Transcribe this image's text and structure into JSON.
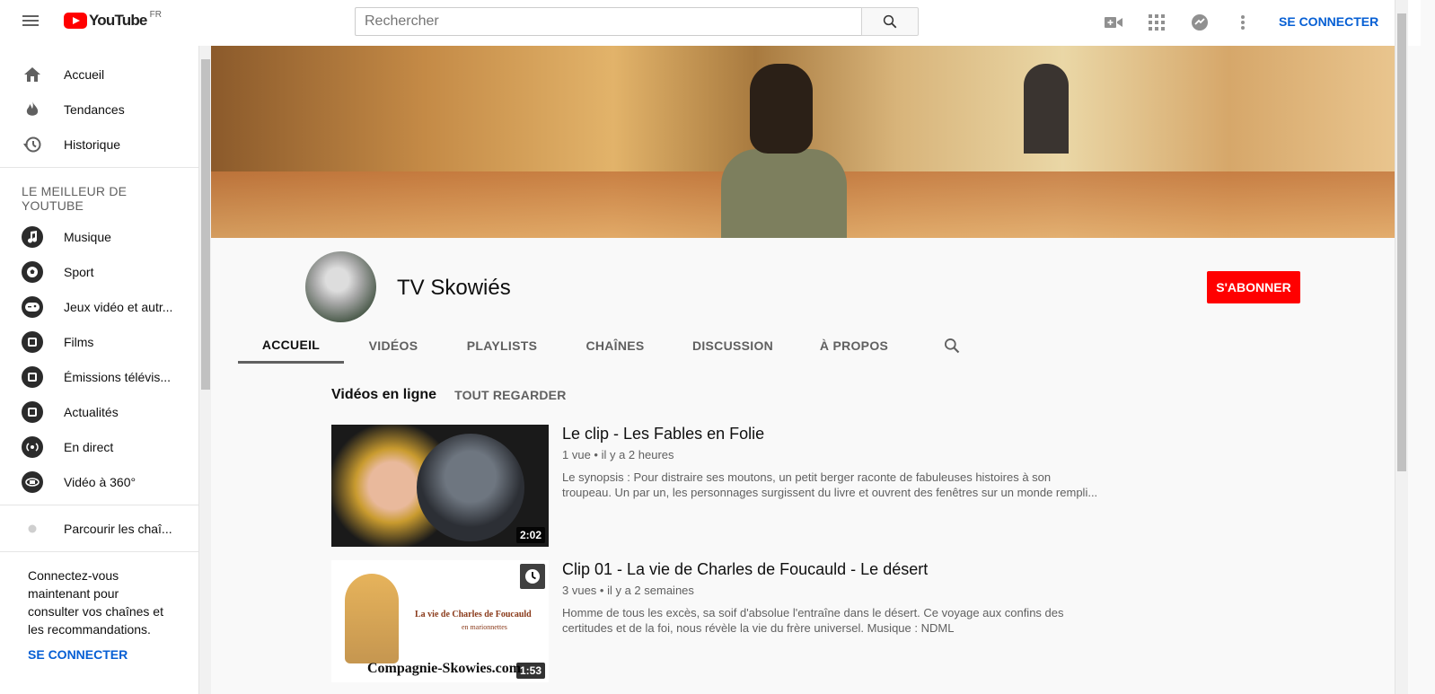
{
  "header": {
    "logo_text": "YouTube",
    "country": "FR",
    "search_placeholder": "Rechercher",
    "signin": "SE CONNECTER"
  },
  "sidebar": {
    "main": [
      {
        "label": "Accueil",
        "icon": "home-icon"
      },
      {
        "label": "Tendances",
        "icon": "fire-icon"
      },
      {
        "label": "Historique",
        "icon": "history-icon"
      }
    ],
    "section_title": "LE MEILLEUR DE YOUTUBE",
    "best": [
      {
        "label": "Musique",
        "icon": "music-icon"
      },
      {
        "label": "Sport",
        "icon": "sport-icon"
      },
      {
        "label": "Jeux vidéo et autr...",
        "icon": "gaming-icon"
      },
      {
        "label": "Films",
        "icon": "film-icon"
      },
      {
        "label": "Émissions télévis...",
        "icon": "tv-icon"
      },
      {
        "label": "Actualités",
        "icon": "news-icon"
      },
      {
        "label": "En direct",
        "icon": "live-icon"
      },
      {
        "label": "Vidéo à 360°",
        "icon": "360-icon"
      }
    ],
    "browse": "Parcourir les chaî...",
    "connect_text": "Connectez-vous maintenant pour consulter vos chaînes et les recommandations.",
    "connect_link": "SE CONNECTER"
  },
  "channel": {
    "name": "TV Skowiés",
    "subscribe": "S'ABONNER",
    "tabs": [
      "ACCUEIL",
      "VIDÉOS",
      "PLAYLISTS",
      "CHAÎNES",
      "DISCUSSION",
      "À PROPOS"
    ]
  },
  "shelf": {
    "title": "Vidéos en ligne",
    "see_all": "TOUT REGARDER",
    "videos": [
      {
        "title": "Le clip - Les Fables en Folie",
        "meta": "1 vue • il y a 2 heures",
        "description": "Le synopsis : Pour distraire ses moutons, un petit berger raconte de fabuleuses histoires à son troupeau. Un par un, les personnages surgissent du livre et ouvrent des fenêtres sur un monde rempli...",
        "duration": "2:02"
      },
      {
        "title": "Clip 01 - La vie de Charles de Foucauld - Le désert",
        "meta": "3 vues • il y a 2 semaines",
        "description": "Homme de tous les excès, sa soif d'absolue l'entraîne dans le désert. Ce voyage aux confins des certitudes et de la foi, nous révèle la vie du frère universel. Musique : NDML",
        "duration": "1:53",
        "thumb_text_1": "La vie de Charles de Foucauld",
        "thumb_text_2": "en marionnettes",
        "thumb_text_3": "Compagnie-Skowies.com"
      }
    ]
  },
  "colors": {
    "red": "#ff0000",
    "link_blue": "#065fd4"
  }
}
